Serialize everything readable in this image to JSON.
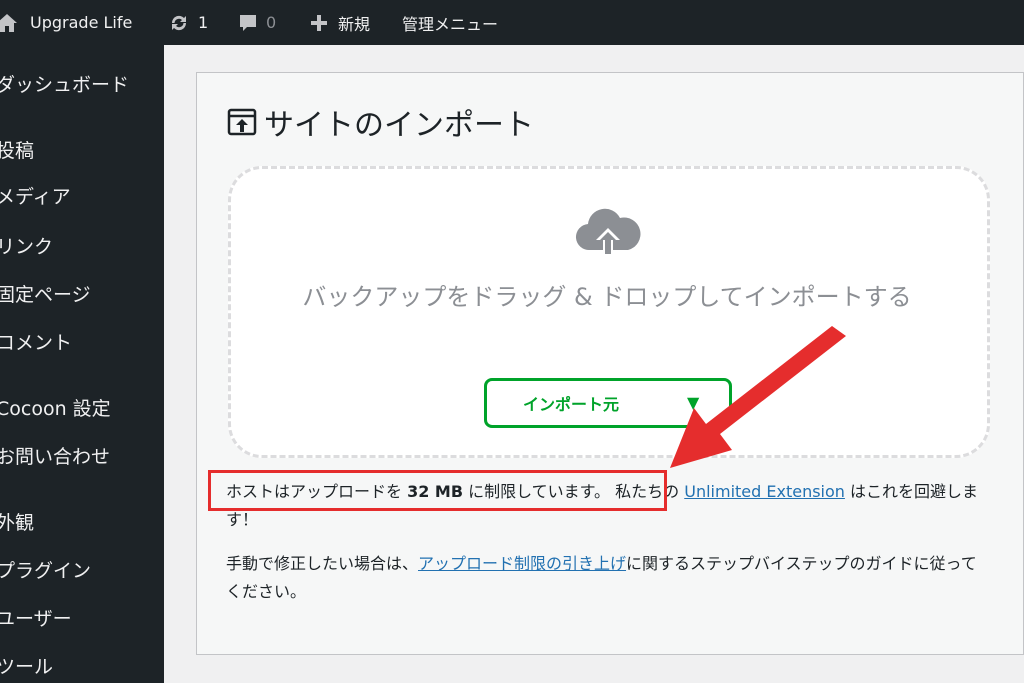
{
  "adminbar": {
    "site_name": "Upgrade Life",
    "updates_count": "1",
    "comments_count": "0",
    "new_label": "新規",
    "admin_menu_label": "管理メニュー"
  },
  "sidebar": {
    "items": [
      {
        "label": "ダッシュボード"
      },
      {
        "label": "投稿"
      },
      {
        "label": "メディア"
      },
      {
        "label": "リンク"
      },
      {
        "label": "固定ページ"
      },
      {
        "label": "コメント"
      },
      {
        "label": "Cocoon 設定"
      },
      {
        "label": "お問い合わせ"
      },
      {
        "label": "外観"
      },
      {
        "label": "プラグイン"
      },
      {
        "label": "ユーザー"
      },
      {
        "label": "ツール"
      }
    ]
  },
  "main": {
    "title": "サイトのインポート",
    "dropzone_text": "バックアップをドラッグ & ドロップしてインポートする",
    "import_button_label": "インポート元",
    "import_button_chevron": "▼",
    "notice": {
      "part1": "ホストはアップロードを ",
      "size": "32 MB",
      "part2": " に制限しています。 私たちの ",
      "link": "Unlimited Extension",
      "part3": " はこれを回避します！"
    },
    "manual": {
      "part1": "手動で修正したい場合は、",
      "link": "アップロード制限の引き上げ",
      "part2": "に関するステップバイステップのガイドに従ってください。"
    }
  },
  "colors": {
    "admin_bg": "#1d2327",
    "accent_green": "#00a32a",
    "link_blue": "#2271b1",
    "annotation_red": "#e52d2d"
  }
}
